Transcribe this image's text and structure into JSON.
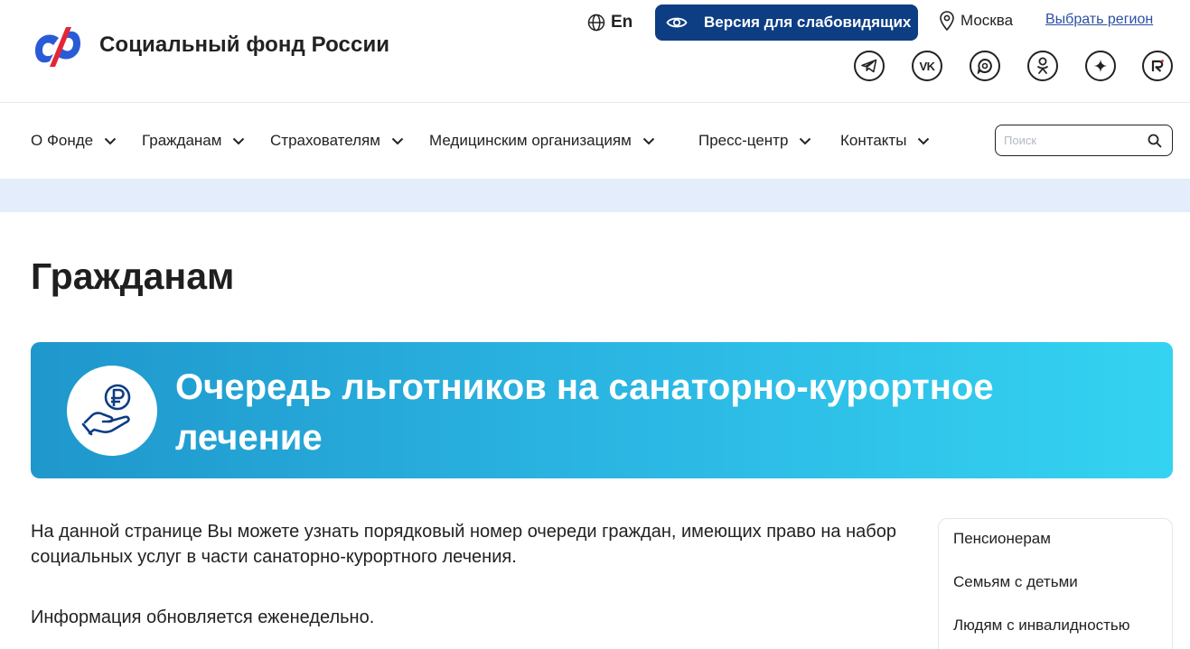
{
  "header": {
    "brand": "Социальный фонд России",
    "lang_label": "En",
    "accessibility_button": "Версия для слабовидящих",
    "city": "Москва",
    "region_link": "Выбрать регион",
    "socials": [
      "telegram-icon",
      "vk-icon",
      "max-icon",
      "odnoklassniki-icon",
      "dzen-icon",
      "rutube-icon"
    ]
  },
  "nav": {
    "items": [
      {
        "label": "О Фонде"
      },
      {
        "label": "Гражданам"
      },
      {
        "label": "Страхователям"
      },
      {
        "label": "Медицинским организациям"
      },
      {
        "label": "Пресс-центр"
      },
      {
        "label": "Контакты"
      }
    ],
    "search_placeholder": "Поиск"
  },
  "main": {
    "title": "Гражданам",
    "banner": {
      "title": "Очередь льготников на санаторно-курортное лечение",
      "icon": "ruble-hand-icon"
    },
    "intro": "На данной странице Вы можете узнать порядковый номер очереди граждан, имеющих право на набор социальных услуг в части санаторно-курортного лечения.",
    "note": "Информация обновляется еженедельно."
  },
  "side_menu": {
    "items": [
      "Пенсионерам",
      "Семьям с детьми",
      "Людям с инвалидностью"
    ]
  },
  "colors": {
    "accent_dark": "#0d3d83",
    "link": "#2d4fa6",
    "band": "#e3edfb",
    "banner_start": "#1f97cc",
    "banner_end": "#34d3f1",
    "logo_blue": "#2a5bd7",
    "logo_red": "#e32636"
  }
}
